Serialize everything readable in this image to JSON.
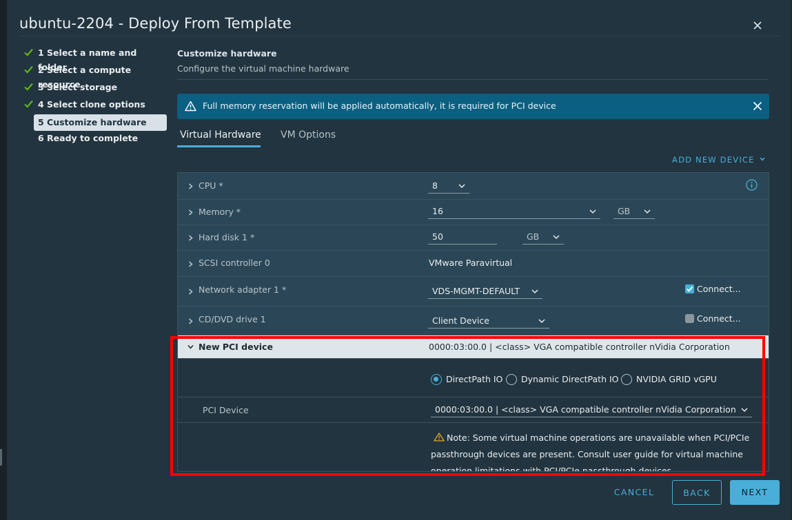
{
  "dialog": {
    "title": "ubuntu-2204 - Deploy From Template"
  },
  "steps": [
    {
      "label": "1 Select a name and folder",
      "done": true
    },
    {
      "label": "2 Select a compute resource",
      "done": true
    },
    {
      "label": "3 Select storage",
      "done": true
    },
    {
      "label": "4 Select clone options",
      "done": true
    },
    {
      "label": "5 Customize hardware",
      "active": true
    },
    {
      "label": "6 Ready to complete"
    }
  ],
  "section": {
    "title": "Customize hardware",
    "subtitle": "Configure the virtual machine hardware"
  },
  "alert": {
    "text": "Full memory reservation will be applied automatically, it is required for PCI device"
  },
  "tabs": [
    {
      "label": "Virtual Hardware",
      "active": true
    },
    {
      "label": "VM Options"
    }
  ],
  "add_device_label": "ADD NEW DEVICE",
  "hardware": {
    "cpu": {
      "label": "CPU *",
      "value": "8"
    },
    "memory": {
      "label": "Memory *",
      "value": "16",
      "unit": "GB"
    },
    "disk": {
      "label": "Hard disk 1 *",
      "value": "50",
      "unit": "GB"
    },
    "scsi": {
      "label": "SCSI controller 0",
      "value": "VMware Paravirtual"
    },
    "network": {
      "label": "Network adapter 1 *",
      "value": "VDS-MGMT-DEFAULT",
      "connect_label": "Connect...",
      "connected": true
    },
    "cddvd": {
      "label": "CD/DVD drive 1",
      "value": "Client Device",
      "connect_label": "Connect...",
      "connected": false
    },
    "pci": {
      "label": "New PCI device",
      "summary": "0000:03:00.0 | <class> VGA compatible controller nVidia Corporation",
      "modes": [
        {
          "label": "DirectPath IO",
          "selected": true
        },
        {
          "label": "Dynamic DirectPath IO",
          "selected": false
        },
        {
          "label": "NVIDIA GRID vGPU",
          "selected": false
        }
      ],
      "device_label": "PCI Device",
      "device_value": "0000:03:00.0 | <class> VGA compatible controller nVidia Corporation",
      "note": "Note: Some virtual machine operations are unavailable when PCI/PCIe passthrough devices are present. Consult user guide for virtual machine operation limitations with PCI/PCIe passthrough devices."
    }
  },
  "buttons": {
    "cancel": "CANCEL",
    "back": "BACK",
    "next": "NEXT"
  },
  "colors": {
    "accent": "#49afd9",
    "success": "#5eb715",
    "highlight": "#ff0000",
    "alert_bg": "#0b5f80"
  },
  "icons": {
    "close": "close-icon",
    "check": "check-icon",
    "warning": "warning-icon",
    "info": "info-icon",
    "chevron": "chevron-icon"
  }
}
